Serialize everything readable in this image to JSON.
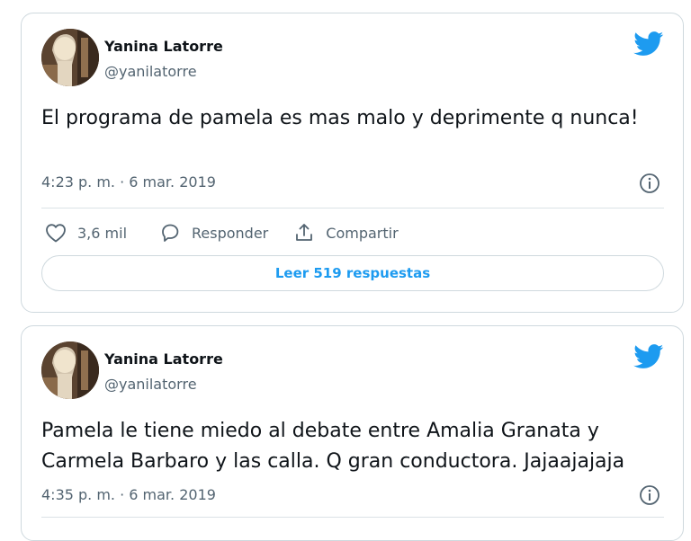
{
  "tweets": [
    {
      "author_name": "Yanina Latorre",
      "author_handle": "@yanilatorre",
      "text": "El programa de pamela es mas malo y deprimente q nunca!",
      "timestamp": "4:23 p. m. · 6 mar. 2019",
      "likes": "3,6 mil",
      "reply_label": "Responder",
      "share_label": "Compartir",
      "read_replies_label": "Leer 519 respuestas"
    },
    {
      "author_name": "Yanina Latorre",
      "author_handle": "@yanilatorre",
      "text": "Pamela le tiene miedo al debate entre Amalia Granata y Carmela Barbaro y las calla. Q gran conductora. Jajaajajaja",
      "timestamp": "4:35 p. m. · 6 mar. 2019"
    }
  ],
  "icons": {
    "brand": "twitter-bird-icon",
    "info": "info-icon",
    "like": "heart-icon",
    "reply": "speech-bubble-icon",
    "share": "share-icon"
  },
  "colors": {
    "twitter_blue": "#1d9bf0",
    "text_primary": "#0f1419",
    "text_secondary": "#536471",
    "border": "#cfd9de"
  }
}
